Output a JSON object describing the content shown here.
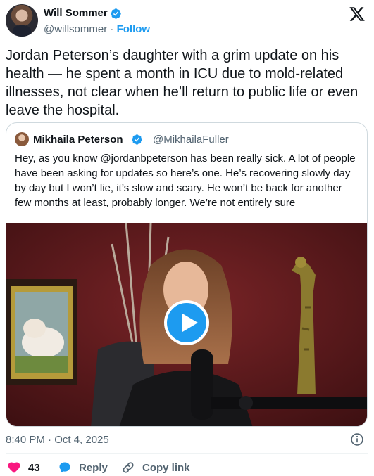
{
  "author": {
    "name": "Will Sommer",
    "handle": "@willsommer",
    "separator": "·",
    "follow_label": "Follow"
  },
  "tweet_text": "Jordan Peterson’s daughter with a grim update on his health — he spent a month in ICU due to mold-related illnesses, not clear when he’ll return to public life or even leave the hospital.",
  "quoted": {
    "name": "Mikhaila Peterson",
    "handle": "@MikhailaFuller",
    "text": "Hey, as you know @jordanbpeterson has been really sick. A lot of people have been asking for updates so here’s one. He’s recovering slowly day by day but I won’t lie, it’s slow and scary. He won’t be back for another few months at least, probably longer. We’re not entirely sure"
  },
  "timestamp": "8:40 PM · Oct 4, 2025",
  "actions": {
    "like_count": "43",
    "reply_label": "Reply",
    "copy_label": "Copy link"
  },
  "icons": {
    "verified": "verified-badge-icon",
    "x_logo": "x-logo-icon",
    "info": "info-icon",
    "heart": "heart-icon",
    "reply": "reply-bubble-icon",
    "link": "link-icon",
    "play": "play-icon"
  },
  "colors": {
    "accent": "#1d9bf0",
    "like": "#f91880",
    "secondary_text": "#536471",
    "border": "#cfd9de"
  }
}
